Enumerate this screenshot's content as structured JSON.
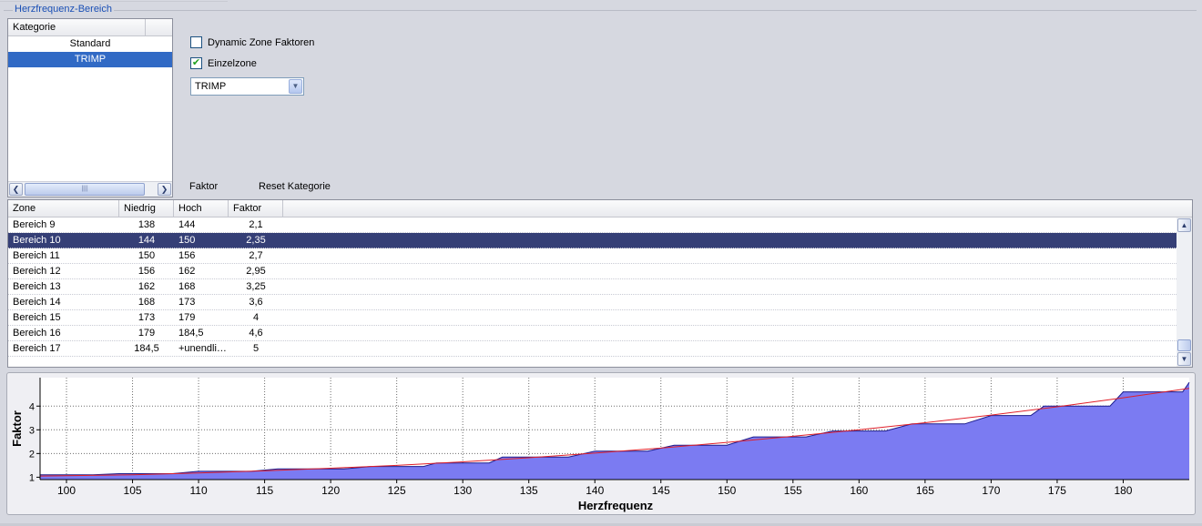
{
  "group": {
    "title": "Herzfrequenz-Bereich"
  },
  "kategorie": {
    "header": "Kategorie",
    "items": [
      {
        "label": "Standard",
        "selected": false
      },
      {
        "label": "TRIMP",
        "selected": true
      }
    ]
  },
  "options": {
    "dynamic_zone": {
      "label": "Dynamic Zone Faktoren",
      "checked": false
    },
    "einzelzone": {
      "label": "Einzelzone",
      "checked": true
    },
    "combo_value": "TRIMP"
  },
  "buttons": {
    "faktor": "Faktor",
    "reset": "Reset Kategorie"
  },
  "zone_table": {
    "columns": [
      "Zone",
      "Niedrig",
      "Hoch",
      "Faktor"
    ],
    "rows": [
      {
        "zone": "Bereich 9",
        "niedrig": "138",
        "hoch": "144",
        "faktor": "2,1",
        "selected": false
      },
      {
        "zone": "Bereich 10",
        "niedrig": "144",
        "hoch": "150",
        "faktor": "2,35",
        "selected": true
      },
      {
        "zone": "Bereich 11",
        "niedrig": "150",
        "hoch": "156",
        "faktor": "2,7",
        "selected": false
      },
      {
        "zone": "Bereich 12",
        "niedrig": "156",
        "hoch": "162",
        "faktor": "2,95",
        "selected": false
      },
      {
        "zone": "Bereich 13",
        "niedrig": "162",
        "hoch": "168",
        "faktor": "3,25",
        "selected": false
      },
      {
        "zone": "Bereich 14",
        "niedrig": "168",
        "hoch": "173",
        "faktor": "3,6",
        "selected": false
      },
      {
        "zone": "Bereich 15",
        "niedrig": "173",
        "hoch": "179",
        "faktor": "4",
        "selected": false
      },
      {
        "zone": "Bereich 16",
        "niedrig": "179",
        "hoch": "184,5",
        "faktor": "4,6",
        "selected": false
      },
      {
        "zone": "Bereich 17",
        "niedrig": "184,5",
        "hoch": "+unendli…",
        "faktor": "5",
        "selected": false
      }
    ]
  },
  "chart_data": {
    "type": "area",
    "xlabel": "Herzfrequenz",
    "ylabel": "Faktor",
    "xlim": [
      98,
      185
    ],
    "ylim": [
      0.9,
      5.2
    ],
    "x_ticks": [
      100,
      105,
      110,
      115,
      120,
      125,
      130,
      135,
      140,
      145,
      150,
      155,
      160,
      165,
      170,
      175,
      180
    ],
    "y_ticks": [
      1,
      2,
      3,
      4
    ],
    "grid": true,
    "step_series": {
      "x": [
        98,
        102,
        104,
        108,
        110,
        114,
        116,
        121,
        123,
        127,
        128,
        132,
        133,
        138,
        140,
        144,
        146,
        150,
        152,
        156,
        158,
        162,
        164,
        168,
        170,
        173,
        174,
        179,
        180,
        184.5,
        185
      ],
      "y": [
        1.1,
        1.1,
        1.15,
        1.15,
        1.25,
        1.25,
        1.35,
        1.35,
        1.45,
        1.45,
        1.6,
        1.6,
        1.85,
        1.85,
        2.1,
        2.1,
        2.35,
        2.35,
        2.7,
        2.7,
        2.95,
        2.95,
        3.25,
        3.25,
        3.6,
        3.6,
        4.0,
        4.0,
        4.6,
        4.6,
        5.0
      ],
      "fill_color": "#7b7bf2",
      "line_color": "#1c1c8c"
    },
    "trend_line": {
      "x": [
        98,
        105,
        110,
        115,
        120,
        125,
        130,
        135,
        140,
        145,
        150,
        155,
        160,
        165,
        170,
        175,
        180,
        185
      ],
      "y": [
        1.05,
        1.1,
        1.18,
        1.27,
        1.38,
        1.5,
        1.65,
        1.82,
        2.02,
        2.23,
        2.47,
        2.73,
        3.0,
        3.3,
        3.62,
        3.97,
        4.35,
        4.75
      ],
      "color": "#e0202a"
    }
  }
}
